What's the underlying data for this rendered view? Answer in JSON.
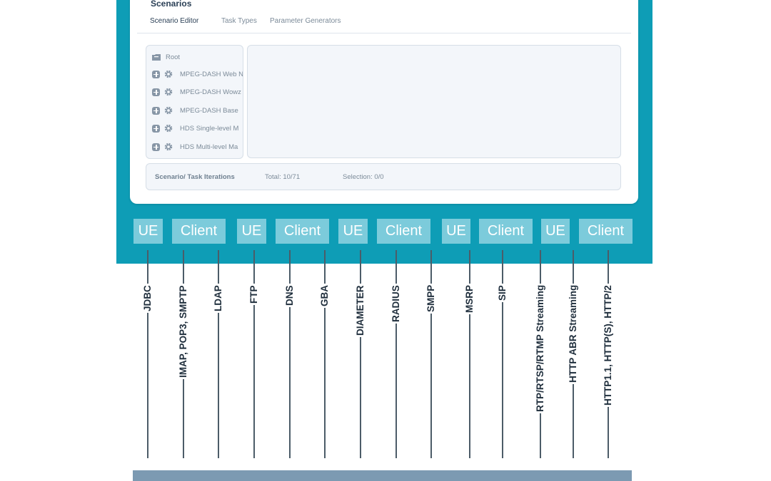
{
  "editor": {
    "title": "Scenarios",
    "tabs": [
      {
        "label": "Scenario Editor",
        "active": true
      },
      {
        "label": "Task Types",
        "active": false
      },
      {
        "label": "Parameter Generators",
        "active": false
      }
    ],
    "tree": {
      "root": "Root",
      "items": [
        {
          "label": "MPEG-DASH Web N"
        },
        {
          "label": "MPEG-DASH Wowz"
        },
        {
          "label": "MPEG-DASH Base"
        },
        {
          "label": "HDS Single-level M"
        },
        {
          "label": "HDS Multi-level Ma"
        }
      ]
    },
    "footer": {
      "label": "Scenario/ Task Iterations",
      "total": "Total: 10/71",
      "selection": "Selection: 0/0"
    }
  },
  "boxes": [
    "UE",
    "Client",
    "UE",
    "Client",
    "UE",
    "Client",
    "UE",
    "Client",
    "UE",
    "Client"
  ],
  "protocols": [
    "JDBC",
    "IMAP, POP3, SMPTP",
    "LDAP",
    "FTP",
    "DNS",
    "GBA",
    "DIAMETER",
    "RADIUS",
    "SMPP",
    "MSRP",
    "SIP",
    "RTP/RTSP/RTMP Streaming",
    "HTTP ABR Streaming",
    "HTTP1.1, HTTP(S), HTTP/2"
  ],
  "colors": {
    "teal": "#0e9db6",
    "box": "#7ccbdb",
    "bottom_bar": "#7c9ab2"
  }
}
